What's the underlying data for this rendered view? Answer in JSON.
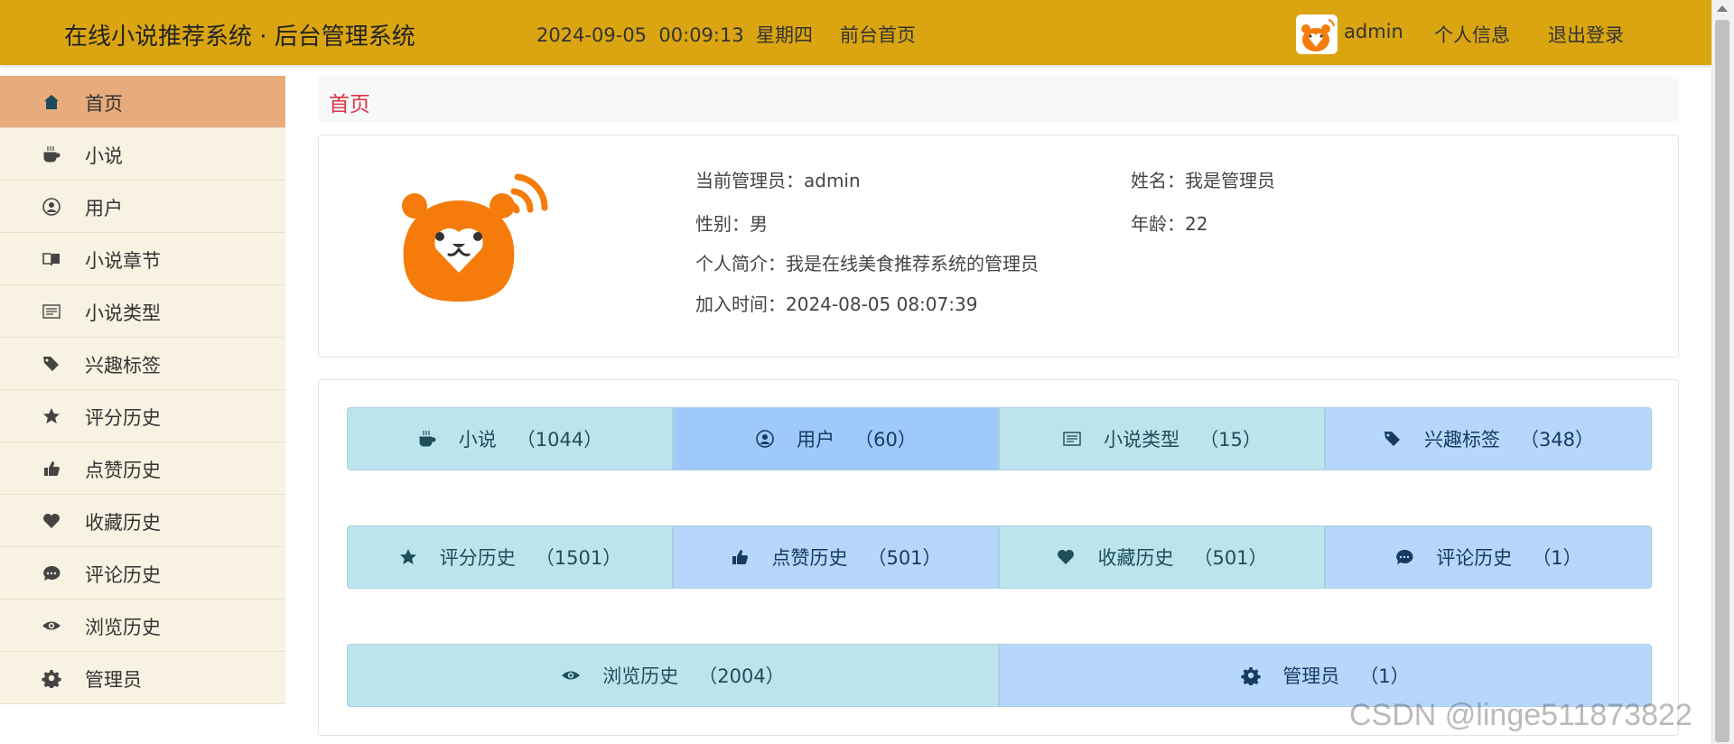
{
  "header": {
    "system_title": "在线小说推荐系统 · 后台管理系统",
    "datetime": "2024-09-05  00:09:13  星期四",
    "frontend_link": "前台首页",
    "admin_name": "admin",
    "profile_link": "个人信息",
    "logout_link": "退出登录",
    "bar_color": "#daa511"
  },
  "sidebar": {
    "items": [
      {
        "label": "首页",
        "icon": "home-icon",
        "active": true
      },
      {
        "label": "小说",
        "icon": "coffee-icon"
      },
      {
        "label": "用户",
        "icon": "user-circle-icon"
      },
      {
        "label": "小说章节",
        "icon": "book-open-icon"
      },
      {
        "label": "小说类型",
        "icon": "list-icon"
      },
      {
        "label": "兴趣标签",
        "icon": "tags-icon"
      },
      {
        "label": "评分历史",
        "icon": "star-icon"
      },
      {
        "label": "点赞历史",
        "icon": "thumbs-up-icon"
      },
      {
        "label": "收藏历史",
        "icon": "heart-icon"
      },
      {
        "label": "评论历史",
        "icon": "comment-icon"
      },
      {
        "label": "浏览历史",
        "icon": "eye-icon"
      },
      {
        "label": "管理员",
        "icon": "gear-icon"
      }
    ]
  },
  "breadcrumb": "首页",
  "profile": {
    "current_admin_label": "当前管理员：",
    "current_admin": "admin",
    "name_label": "姓名：",
    "name": "我是管理员",
    "gender_label": "性别：",
    "gender": "男",
    "age_label": "年龄：",
    "age": "22",
    "bio_label": "个人简介：",
    "bio": "我是在线美食推荐系统的管理员",
    "joined_label": "加入时间：",
    "joined": "2024-08-05 08:07:39"
  },
  "stats": {
    "row1": [
      {
        "label": "小说",
        "count": "（1044）",
        "icon": "coffee-icon"
      },
      {
        "label": "用户",
        "count": "（60）",
        "icon": "user-circle-icon"
      },
      {
        "label": "小说类型",
        "count": "（15）",
        "icon": "list-icon"
      },
      {
        "label": "兴趣标签",
        "count": "（348）",
        "icon": "tags-icon"
      }
    ],
    "row2": [
      {
        "label": "评分历史",
        "count": "（1501）",
        "icon": "star-icon"
      },
      {
        "label": "点赞历史",
        "count": "（501）",
        "icon": "thumbs-up-icon"
      },
      {
        "label": "收藏历史",
        "count": "（501）",
        "icon": "heart-icon"
      },
      {
        "label": "评论历史",
        "count": "（1）",
        "icon": "comment-icon"
      }
    ],
    "row3": [
      {
        "label": "浏览历史",
        "count": "（2004）",
        "icon": "eye-icon"
      },
      {
        "label": "管理员",
        "count": "（1）",
        "icon": "gear-icon"
      }
    ]
  },
  "watermark": "CSDN @linge511873822"
}
